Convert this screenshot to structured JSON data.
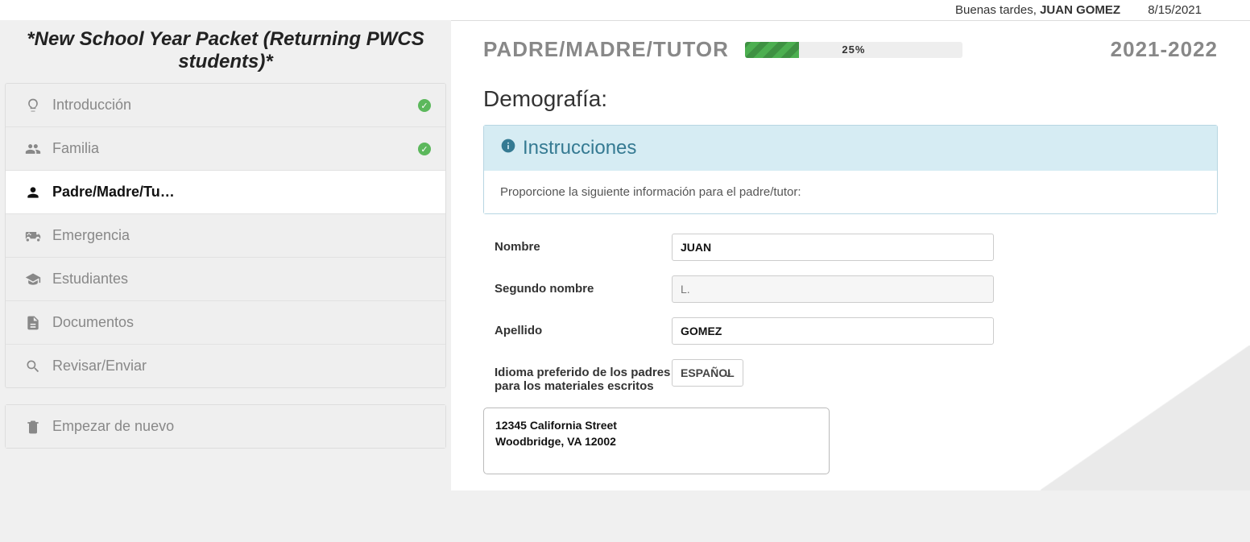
{
  "banner": {
    "greeting": "Buenas tardes,",
    "username": "JUAN GOMEZ",
    "date": "8/15/2021"
  },
  "sidebar": {
    "title": "*New School Year Packet (Returning PWCS students)*",
    "items": [
      {
        "label": "Introducción",
        "icon": "lightbulb",
        "done": true,
        "active": false
      },
      {
        "label": "Familia",
        "icon": "users",
        "done": true,
        "active": false
      },
      {
        "label": "Padre/Madre/Tu…",
        "icon": "person",
        "done": false,
        "active": true
      },
      {
        "label": "Emergencia",
        "icon": "ambulance",
        "done": false,
        "active": false
      },
      {
        "label": "Estudiantes",
        "icon": "gradcap",
        "done": false,
        "active": false
      },
      {
        "label": "Documentos",
        "icon": "doc",
        "done": false,
        "active": false
      },
      {
        "label": "Revisar/Enviar",
        "icon": "search",
        "done": false,
        "active": false
      }
    ],
    "restart": "Empezar de nuevo"
  },
  "main": {
    "title": "PADRE/MADRE/TUTOR",
    "progress_percent": "25%",
    "year": "2021-2022",
    "section": "Demografía:",
    "instructions_title": "Instrucciones",
    "instructions_body": "Proporcione la siguiente información para el padre/tutor:",
    "form": {
      "nombre_label": "Nombre",
      "nombre_value": "JUAN",
      "segundo_label": "Segundo nombre",
      "segundo_placeholder": "L.",
      "apellido_label": "Apellido",
      "apellido_value": "GOMEZ",
      "idioma_label": "Idioma preferido de los padres para los materiales escritos",
      "idioma_value": "ESPAÑOL"
    },
    "address": {
      "line1": "12345 California Street",
      "line2": "Woodbridge, VA 12002"
    }
  }
}
